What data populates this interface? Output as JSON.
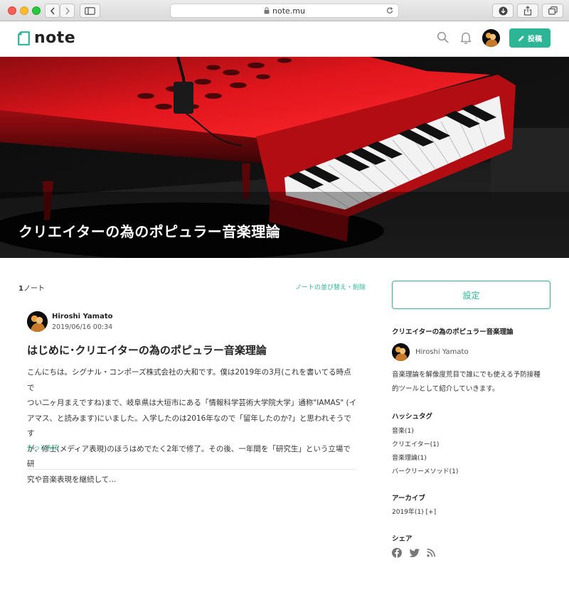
{
  "browser": {
    "url": "note.mu"
  },
  "header": {
    "logo_text": "note",
    "post_button_label": "投稿"
  },
  "hero": {
    "title": "クリエイターの為のポピュラー音楽理論"
  },
  "list": {
    "count_number": "1",
    "count_unit": "ノート",
    "sort_delete_label": "ノートの並び替え・削除"
  },
  "note": {
    "author": "Hiroshi Yamato",
    "date": "2019/06/16 00:34",
    "title": "はじめに･クリエイターの為のポピュラー音楽理論",
    "body_lines": [
      "こんにちは。シグナル・コンポーズ株式会社の大和です。僕は2019年の3月(これを書いてる時点で",
      "つい二ヶ月まえですね)まで、岐阜県は大垣市にある「情報科学芸術大学院大学」通称\"IAMAS\" (イ",
      "アマス、と読みます)にいました。入学したのは2016年なので「留年したのか?」と思われそうです",
      "が、修士(メディア表現)のほうはめでたく2年で修了。その後、一年間を「研究生」という立場で研",
      "究や音楽表現を継続して..."
    ],
    "more_label": "もっとみる"
  },
  "sidebar": {
    "settings_label": "設定",
    "magazine_title": "クリエイターの為のポピュラー音楽理論",
    "author": "Hiroshi Yamato",
    "description_lines": [
      "音楽理論を解像度荒目で誰にでも使える予防接種",
      "的ツールとして紹介していきます。"
    ],
    "hashtag_heading": "ハッシュタグ",
    "hashtags": [
      "音楽(1)",
      "クリエイター(1)",
      "音楽理論(1)",
      "バークリーメソッド(1)"
    ],
    "archive_heading": "アーカイブ",
    "archive_item": "2019年(1) [+]",
    "share_heading": "シェア",
    "share_icons": [
      "facebook-icon",
      "twitter-icon",
      "rss-icon"
    ]
  },
  "colors": {
    "accent": "#2cb696",
    "piano_red": "#d8131b"
  }
}
